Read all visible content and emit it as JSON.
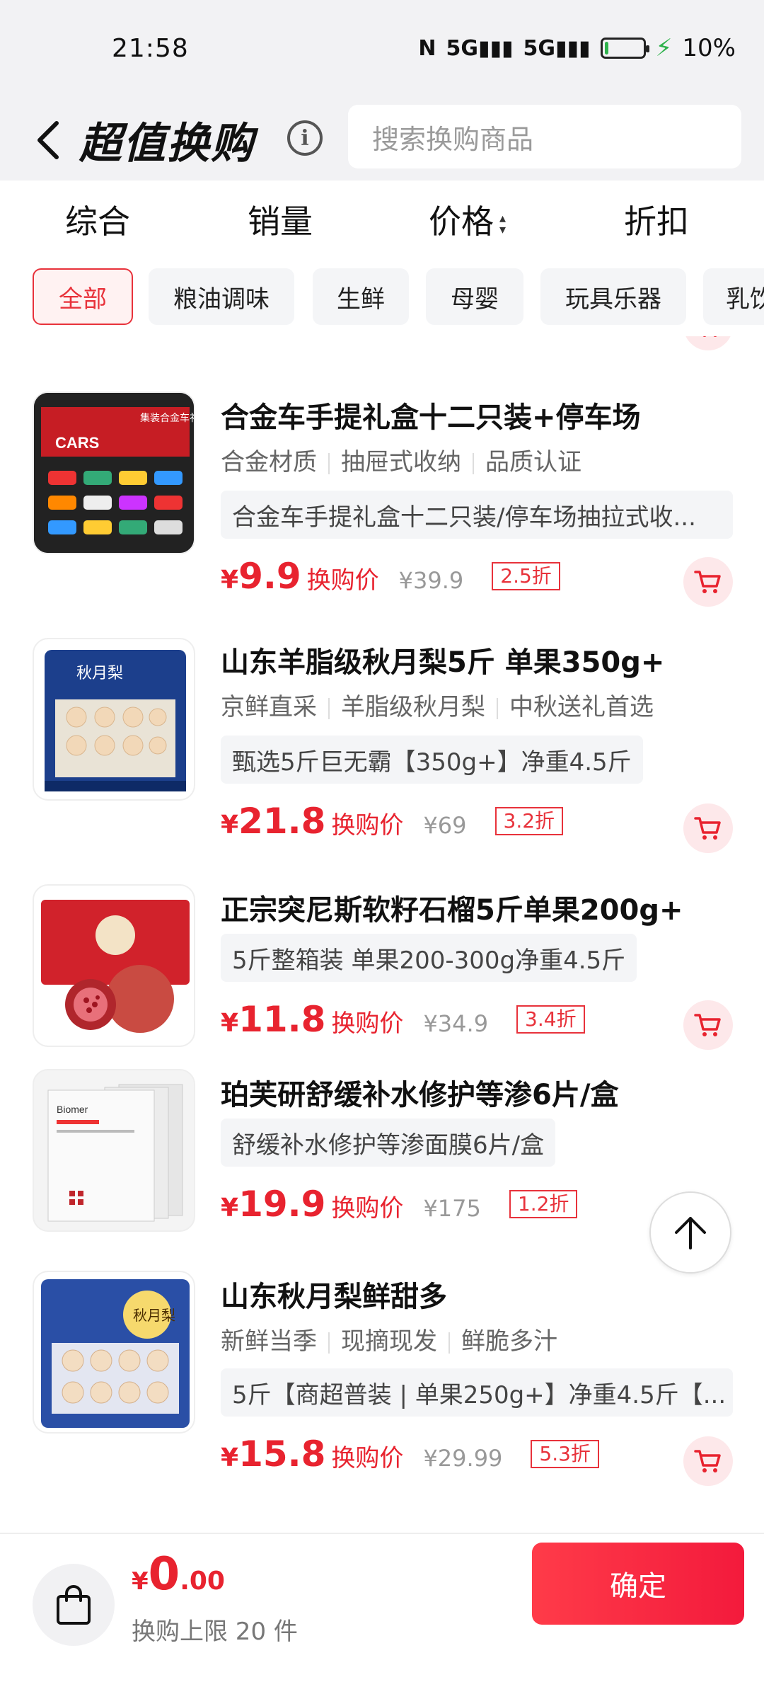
{
  "status_bar": {
    "time": "21:58",
    "signal_1": "5G",
    "signal_2": "5G",
    "battery_percent": "10%",
    "battery_level": 0.1
  },
  "header": {
    "title": "超值换购",
    "search_placeholder": "搜索换购商品"
  },
  "sort_tabs": [
    {
      "label": "综合"
    },
    {
      "label": "销量"
    },
    {
      "label": "价格"
    },
    {
      "label": "折扣"
    }
  ],
  "categories": [
    {
      "label": "全部",
      "active": true
    },
    {
      "label": "粮油调味"
    },
    {
      "label": "生鲜"
    },
    {
      "label": "母婴"
    },
    {
      "label": "玩具乐器"
    },
    {
      "label": "乳饮"
    }
  ],
  "products": [
    {
      "title": "合金车手提礼盒十二只装+停车场",
      "tags": [
        "合金材质",
        "抽屉式收纳",
        "品质认证"
      ],
      "desc": "合金车手提礼盒十二只装/停车场抽拉式收...",
      "price": "9.9",
      "price_label": "换购价",
      "orig_price": "¥39.9",
      "discount": "2.5折",
      "thumb_text": "集装合金车礼盒"
    },
    {
      "title": "山东羊脂级秋月梨5斤 单果350g+",
      "tags": [
        "京鲜直采",
        "羊脂级秋月梨",
        "中秋送礼首选"
      ],
      "desc": "甄选5斤巨无霸【350g+】净重4.5斤",
      "price": "21.8",
      "price_label": "换购价",
      "orig_price": "¥69",
      "discount": "3.2折",
      "thumb_text": "秋月梨"
    },
    {
      "title": "正宗突尼斯软籽石榴5斤单果200g+",
      "tags": [],
      "desc": "5斤整箱装 单果200-300g净重4.5斤",
      "price": "11.8",
      "price_label": "换购价",
      "orig_price": "¥34.9",
      "discount": "3.4折",
      "thumb_text": ""
    },
    {
      "title": "珀芙研舒缓补水修护等渗6片/盒",
      "tags": [],
      "desc": "舒缓补水修护等渗面膜6片/盒",
      "price": "19.9",
      "price_label": "换购价",
      "orig_price": "¥175",
      "discount": "1.2折",
      "thumb_text": "Biomer"
    },
    {
      "title": "山东秋月梨鲜甜多",
      "tags": [
        "新鲜当季",
        "现摘现发",
        "鲜脆多汁"
      ],
      "desc": "5斤【商超普装 | 单果250g+】净重4.5斤【...",
      "price": "15.8",
      "price_label": "换购价",
      "orig_price": "¥29.99",
      "discount": "5.3折",
      "thumb_text": "秋月梨"
    }
  ],
  "bottom_bar": {
    "currency": "¥",
    "total_int": "0",
    "total_dec": ".00",
    "limit_text": "换购上限 20 件",
    "confirm_label": "确定"
  },
  "colors": {
    "accent": "#e8232f",
    "chip_active_bg": "#fff2f2",
    "header_bg": "#f2f2f4"
  }
}
